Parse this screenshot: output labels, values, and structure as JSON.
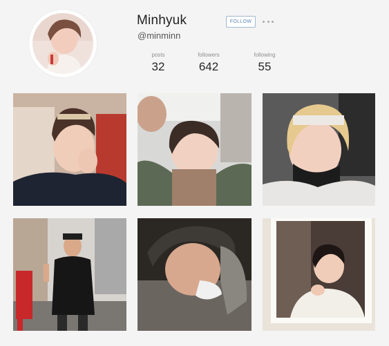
{
  "profile": {
    "username": "Minhyuk",
    "handle": "@minminn",
    "follow_label": "FOLLOW"
  },
  "stats": {
    "posts_label": "posts",
    "posts_value": "32",
    "followers_label": "followers",
    "followers_value": "642",
    "following_label": "following",
    "following_value": "55"
  },
  "icons": {
    "more": "more-options-icon"
  },
  "colors": {
    "background": "#f4f4f4",
    "follow_border": "#9fb8cf",
    "follow_text": "#5a86b3"
  }
}
